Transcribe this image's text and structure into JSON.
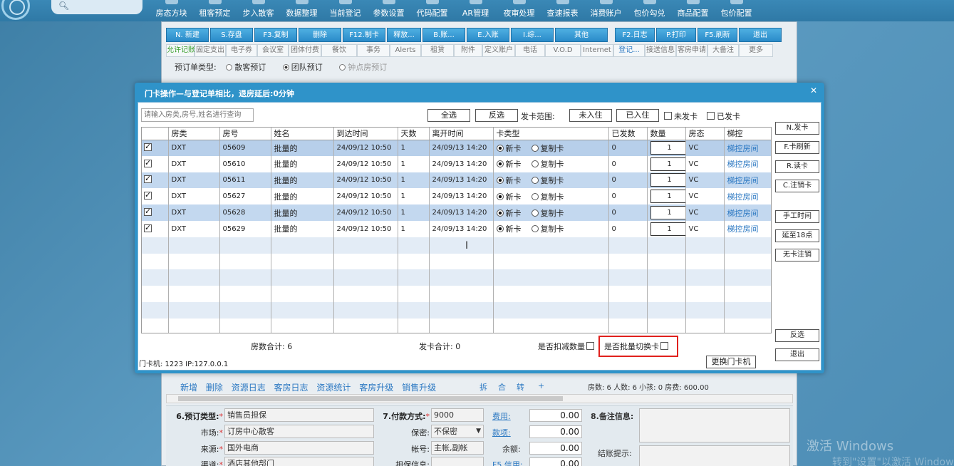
{
  "topbar": {
    "search_icon": "search-icon",
    "items": [
      "房态方块",
      "租客预定",
      "步入散客",
      "数据整理",
      "当前登记",
      "参数设置",
      "代码配置",
      "AR管理",
      "夜审处理",
      "查速报表",
      "消费账户",
      "包价勾兑",
      "商品配置",
      "包价配置"
    ]
  },
  "bgwin": {
    "buttons": [
      {
        "label": "N. 新建",
        "w": 60
      },
      {
        "label": "S.存盘",
        "w": 60
      },
      {
        "label": "F3.复制",
        "w": 60
      },
      {
        "label": "删除",
        "w": 60
      },
      {
        "label": "F12.制卡",
        "w": 60
      },
      {
        "label": "释放...",
        "w": 48
      },
      {
        "label": "B.账...",
        "w": 60
      },
      {
        "label": "E.入账",
        "w": 60
      },
      {
        "label": "I.综...",
        "w": 60
      },
      {
        "label": "其他",
        "w": 74
      },
      {
        "label": "F2.日志",
        "w": 56
      },
      {
        "label": "P.打印",
        "w": 56
      },
      {
        "label": "F5.刷新",
        "w": 56
      },
      {
        "label": "退出",
        "w": 60
      }
    ],
    "tabs": [
      "允许记账",
      "固定支出",
      "电子券",
      "会议室",
      "团体付费",
      "餐饮",
      "事务",
      "Alerts",
      "租赁",
      "附件",
      "定义账户",
      "电话",
      "V.O.D",
      "Internet",
      "登记...",
      "接送信息",
      "客房申请",
      "大备注",
      "更多"
    ],
    "order_type_label": "预订单类型:",
    "order_types": [
      "散客预订",
      "团队预订",
      "钟点房预订"
    ],
    "links": [
      "新增",
      "删除",
      "资源日志",
      "客房日志",
      "资源统计",
      "客房升级",
      "销售升级"
    ],
    "link_extra": [
      "拆",
      "合",
      "转",
      "+"
    ],
    "stats": "房数: 6   人数: 6   小孩: 0   房费: 600.00",
    "form": {
      "order_type_label": "6.预订类型:",
      "order_type": "销售员担保",
      "market_label": "市场:",
      "market": "订房中心散客",
      "source_label": "来源:",
      "source": "国外电商",
      "channel_label": "渠道:",
      "channel": "酒店其他部门",
      "pay_label": "7.付款方式:",
      "pay": "9000",
      "secret_label": "保密:",
      "secret": "不保密",
      "acct_label": "帐号:",
      "acct": "主帐,副帐",
      "guarantee_label": "担保信息:",
      "fee_link": "费用:",
      "fee": "0.00",
      "deposit_link": "款项:",
      "deposit": "0.00",
      "balance_label": "余额:",
      "balance": "0.00",
      "credit_link": "F5.信用:",
      "credit": "0.00",
      "remark_label": "8.备注信息:",
      "checkout_label": "结账提示:"
    }
  },
  "modal": {
    "title": "门卡操作—与登记单相比，退房延后:0分钟",
    "close_icon": "close-icon",
    "filter_placeholder": "请输入房类,房号,姓名进行查询",
    "select_all": "全选",
    "invert": "反选",
    "range_label": "发卡范围:",
    "not_checked_in": "未入住",
    "checked_in": "已入住",
    "not_issued": "未发卡",
    "issued": "已发卡",
    "columns": [
      "",
      "房类",
      "房号",
      "姓名",
      "到达时间",
      "天数",
      "离开时间",
      "卡类型",
      "已发数",
      "数量",
      "房态",
      "梯控"
    ],
    "rows": [
      {
        "type": "DXT",
        "room": "05609",
        "name": "批量的",
        "arrive": "24/09/12 10:50",
        "days": "1",
        "depart": "24/09/13 14:20",
        "new_card": "新卡",
        "copy_card": "复制卡",
        "issued": "0",
        "qty": "1",
        "status": "VC",
        "elevator": "梯控房间"
      },
      {
        "type": "DXT",
        "room": "05610",
        "name": "批量的",
        "arrive": "24/09/12 10:50",
        "days": "1",
        "depart": "24/09/13 14:20",
        "new_card": "新卡",
        "copy_card": "复制卡",
        "issued": "0",
        "qty": "1",
        "status": "VC",
        "elevator": "梯控房间"
      },
      {
        "type": "DXT",
        "room": "05611",
        "name": "批量的",
        "arrive": "24/09/12 10:50",
        "days": "1",
        "depart": "24/09/13 14:20",
        "new_card": "新卡",
        "copy_card": "复制卡",
        "issued": "0",
        "qty": "1",
        "status": "VC",
        "elevator": "梯控房间"
      },
      {
        "type": "DXT",
        "room": "05627",
        "name": "批量的",
        "arrive": "24/09/12 10:50",
        "days": "1",
        "depart": "24/09/13 14:20",
        "new_card": "新卡",
        "copy_card": "复制卡",
        "issued": "0",
        "qty": "1",
        "status": "VC",
        "elevator": "梯控房间"
      },
      {
        "type": "DXT",
        "room": "05628",
        "name": "批量的",
        "arrive": "24/09/12 10:50",
        "days": "1",
        "depart": "24/09/13 14:20",
        "new_card": "新卡",
        "copy_card": "复制卡",
        "issued": "0",
        "qty": "1",
        "status": "VC",
        "elevator": "梯控房间"
      },
      {
        "type": "DXT",
        "room": "05629",
        "name": "批量的",
        "arrive": "24/09/12 10:50",
        "days": "1",
        "depart": "24/09/13 14:20",
        "new_card": "新卡",
        "copy_card": "复制卡",
        "issued": "0",
        "qty": "1",
        "status": "VC",
        "elevator": "梯控房间"
      }
    ],
    "side_buttons": [
      "N.发卡",
      "F.卡刷新",
      "R.读卡",
      "C.注销卡",
      "手工时间",
      "延至18点",
      "无卡注销",
      "反选",
      "退出"
    ],
    "room_total": "房数合计: 6",
    "card_total": "发卡合计: 0",
    "deduct_label": "是否扣减数量",
    "batch_label": "是否批量切换卡",
    "card_machine": "门卡机: 1223 IP:127.0.0.1",
    "change_machine": "更换门卡机"
  },
  "watermark": {
    "line1": "激活 Windows",
    "line2": "转到\"设置\"以激活 Windows。"
  }
}
